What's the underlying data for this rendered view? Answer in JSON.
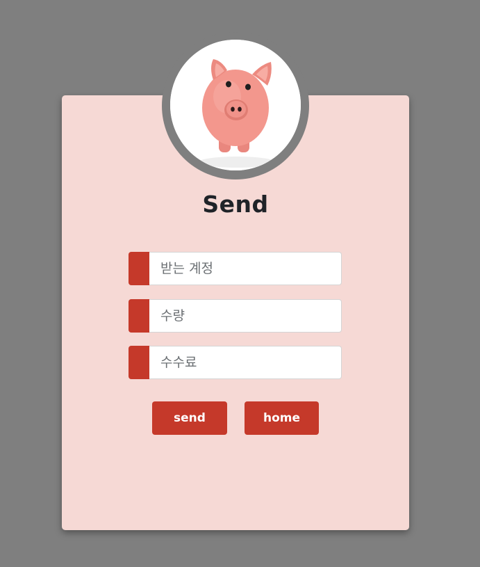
{
  "page": {
    "title": "Send"
  },
  "avatar": {
    "icon": "piggy-bank-photo"
  },
  "form": {
    "fields": [
      {
        "placeholder": "받는 계정",
        "value": ""
      },
      {
        "placeholder": "수량",
        "value": ""
      },
      {
        "placeholder": "수수료",
        "value": ""
      }
    ]
  },
  "actions": {
    "send_label": "send",
    "home_label": "home"
  },
  "colors": {
    "background": "#7f7f7f",
    "card": "#f6d9d5",
    "accent": "#c5392a",
    "title": "#1f2328"
  }
}
